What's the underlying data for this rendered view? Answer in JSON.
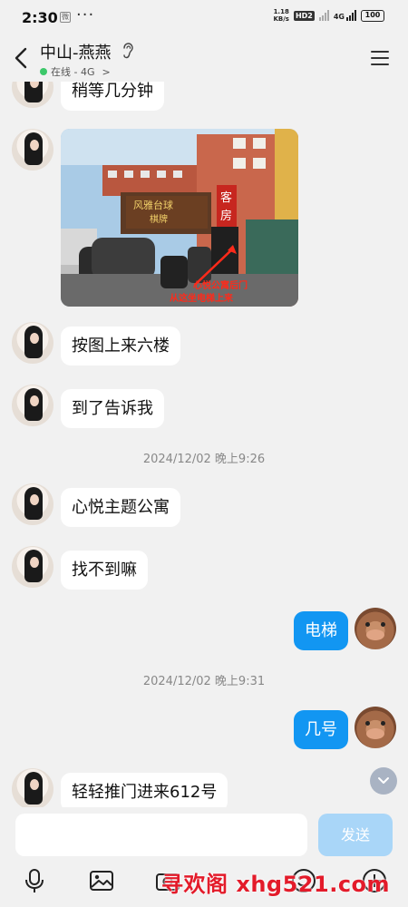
{
  "status_bar": {
    "time": "2:30",
    "app_badge": "微",
    "more": "···",
    "net_speed_top": "1.18",
    "net_speed_bottom": "KB/s",
    "hd": "HD2",
    "network": "4G",
    "battery": "100"
  },
  "header": {
    "title": "中山-燕燕",
    "online_status": "在线 - 4G",
    "chevron": ">"
  },
  "photo_sign": {
    "shop_text": "风雅台球",
    "shop_sub": "棋牌",
    "vertical_sign": "客房",
    "annotation_line1": "心悦公寓后门",
    "annotation_line2": "从这坐电梯上来"
  },
  "messages": [
    {
      "text": "稍等几分钟"
    },
    {
      "text": "按图上来六楼"
    },
    {
      "text": "到了告诉我"
    },
    {
      "text": "心悦主题公寓"
    },
    {
      "text": "找不到嘛"
    },
    {
      "text": "电梯"
    },
    {
      "text": "几号"
    },
    {
      "text": "轻轻推门进来612号"
    }
  ],
  "timestamps": [
    "2024/12/02 晚上9:26",
    "2024/12/02 晚上9:31"
  ],
  "input": {
    "value": "",
    "send_label": "发送"
  },
  "watermark": "寻欢阁 xhg521.com",
  "colors": {
    "accent": "#1296f2",
    "send_disabled": "#a9d6f8",
    "online": "#3cc86a"
  }
}
